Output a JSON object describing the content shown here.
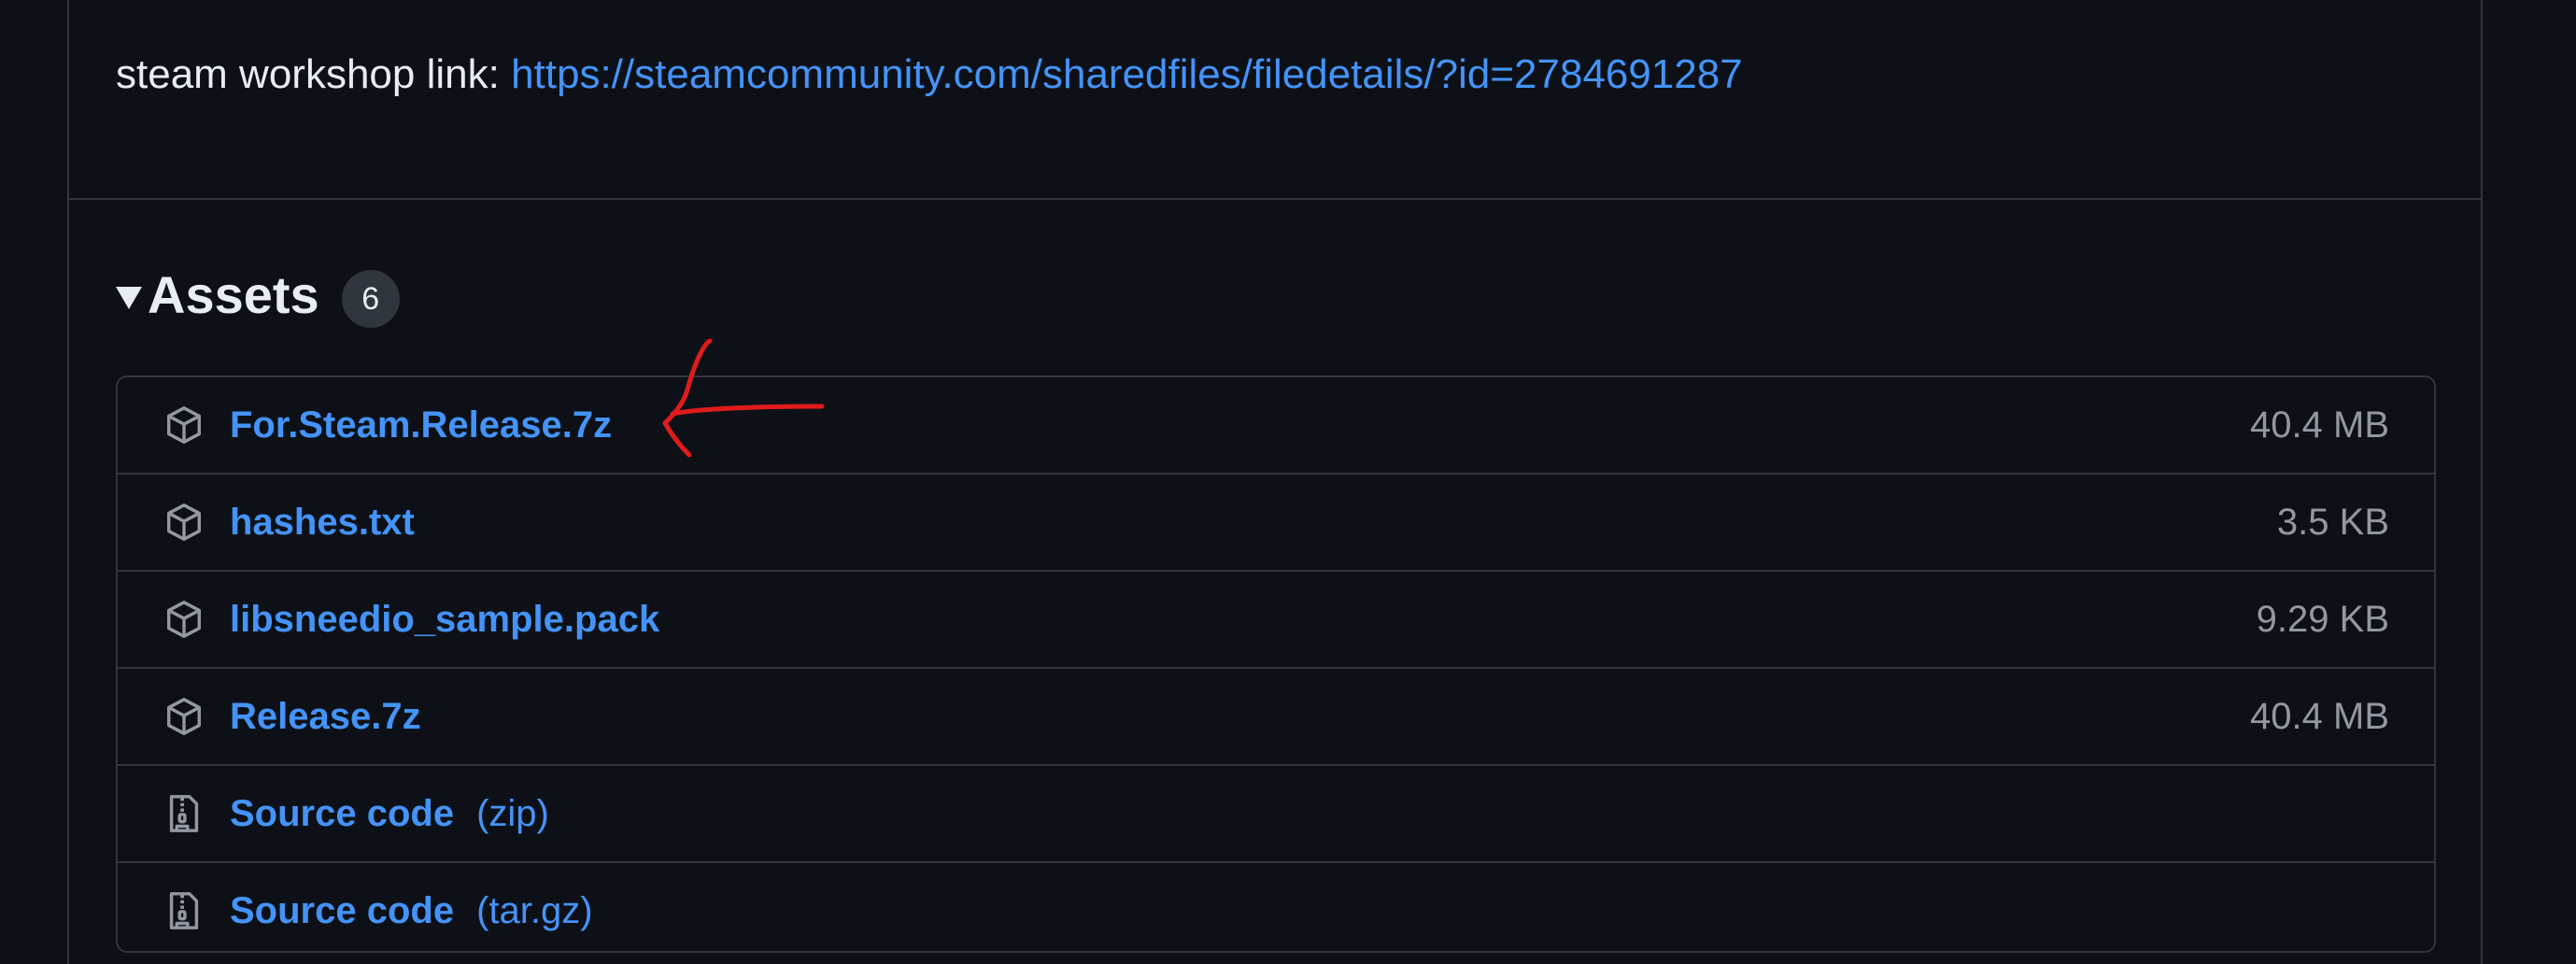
{
  "workshop": {
    "label": "steam workshop link:",
    "url": "https://steamcommunity.com/sharedfiles/filedetails/?id=2784691287"
  },
  "assets": {
    "title": "Assets",
    "count": "6",
    "items": [
      {
        "name": "For.Steam.Release.7z",
        "suffix": "",
        "size": "40.4 MB",
        "icon": "package-icon"
      },
      {
        "name": "hashes.txt",
        "suffix": "",
        "size": "3.5 KB",
        "icon": "package-icon"
      },
      {
        "name": "libsneedio_sample.pack",
        "suffix": "",
        "size": "9.29 KB",
        "icon": "package-icon"
      },
      {
        "name": "Release.7z",
        "suffix": "",
        "size": "40.4 MB",
        "icon": "package-icon"
      },
      {
        "name": "Source code",
        "suffix": "(zip)",
        "size": "",
        "icon": "file-zip-icon"
      },
      {
        "name": "Source code",
        "suffix": "(tar.gz)",
        "size": "",
        "icon": "file-zip-icon"
      }
    ]
  },
  "colors": {
    "background": "#0d1117",
    "border": "#30363d",
    "link": "#4493f8",
    "text": "#e6edf3",
    "muted": "#9198a1",
    "annotation": "#e01b1b"
  }
}
